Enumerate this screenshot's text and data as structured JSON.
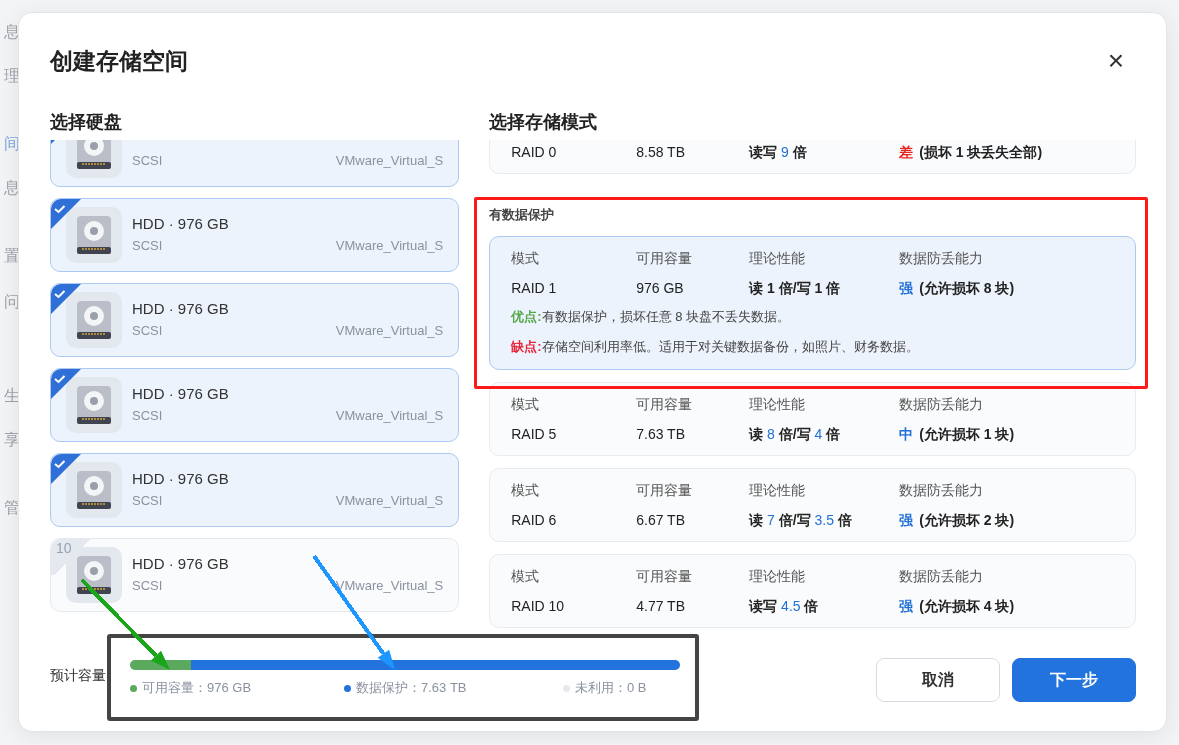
{
  "background_sidebar": [
    {
      "label": "息",
      "selected": false
    },
    {
      "label": "理",
      "selected": false
    },
    {
      "label": "间",
      "selected": true
    },
    {
      "label": "息",
      "selected": false
    },
    {
      "label": "置",
      "selected": false
    },
    {
      "label": "问",
      "selected": false
    },
    {
      "label": "生",
      "selected": false
    },
    {
      "label": "享",
      "selected": false
    },
    {
      "label": "管",
      "selected": false
    }
  ],
  "dialog": {
    "title": "创建存储空间",
    "close": "×"
  },
  "disk_panel": {
    "heading": "选择硬盘",
    "disks": [
      {
        "interface": "SCSI",
        "model": "VMware_Virtual_S",
        "selected": true
      },
      {
        "title": "HDD · 976 GB",
        "interface": "SCSI",
        "model": "VMware_Virtual_S",
        "selected": true
      },
      {
        "title": "HDD · 976 GB",
        "interface": "SCSI",
        "model": "VMware_Virtual_S",
        "selected": true
      },
      {
        "title": "HDD · 976 GB",
        "interface": "SCSI",
        "model": "VMware_Virtual_S",
        "selected": true
      },
      {
        "title": "HDD · 976 GB",
        "interface": "SCSI",
        "model": "VMware_Virtual_S",
        "selected": true
      },
      {
        "title": "HDD · 976 GB",
        "interface": "SCSI",
        "model": "VMware_Virtual_S",
        "selected": false,
        "number": "10"
      }
    ]
  },
  "mode_panel": {
    "heading": "选择存储模式",
    "sections": [
      {
        "cards": [
          {
            "selected": false,
            "mode": "RAID 0",
            "capacity": "8.58 TB",
            "performance": [
              {
                "text": "读写 "
              },
              {
                "text": "9",
                "highlight": true
              },
              {
                "text": " 倍"
              }
            ],
            "rating": {
              "text": "差",
              "color": "#e8261e"
            },
            "rating_note": "(损坏 1 块丢失全部)"
          }
        ]
      },
      {
        "label": "有数据保护",
        "cards": [
          {
            "selected": true,
            "headers": [
              "模式",
              "可用容量",
              "理论性能",
              "数据防丢能力"
            ],
            "mode": "RAID 1",
            "capacity": "976 GB",
            "performance": [
              {
                "text": "读 1 倍/写 1 倍"
              }
            ],
            "rating": {
              "text": "强",
              "color": "#1f6fd6"
            },
            "rating_note": "(允许损坏 8 块)",
            "pros_label": "优点:",
            "pros": "有数据保护，损坏任意 8 块盘不丢失数据。",
            "cons_label": "缺点:",
            "cons": "存储空间利用率低。适用于对关键数据备份，如照片、财务数据。"
          },
          {
            "selected": false,
            "headers": [
              "模式",
              "可用容量",
              "理论性能",
              "数据防丢能力"
            ],
            "mode": "RAID 5",
            "capacity": "7.63 TB",
            "performance": [
              {
                "text": "读 "
              },
              {
                "text": "8",
                "highlight": true
              },
              {
                "text": " 倍/写 "
              },
              {
                "text": "4",
                "highlight": true
              },
              {
                "text": " 倍"
              }
            ],
            "rating": {
              "text": "中",
              "color": "#1f6fd6"
            },
            "rating_note": "(允许损坏 1 块)"
          },
          {
            "selected": false,
            "headers": [
              "模式",
              "可用容量",
              "理论性能",
              "数据防丢能力"
            ],
            "mode": "RAID 6",
            "capacity": "6.67 TB",
            "performance": [
              {
                "text": "读 "
              },
              {
                "text": "7",
                "highlight": true
              },
              {
                "text": " 倍/写 "
              },
              {
                "text": "3.5",
                "highlight": true
              },
              {
                "text": " 倍"
              }
            ],
            "rating": {
              "text": "强",
              "color": "#1f6fd6"
            },
            "rating_note": "(允许损坏 2 块)"
          },
          {
            "selected": false,
            "headers": [
              "模式",
              "可用容量",
              "理论性能",
              "数据防丢能力"
            ],
            "mode": "RAID 10",
            "capacity": "4.77 TB",
            "performance": [
              {
                "text": "读写 "
              },
              {
                "text": "4.5",
                "highlight": true
              },
              {
                "text": " 倍"
              }
            ],
            "rating": {
              "text": "强",
              "color": "#1f6fd6"
            },
            "rating_note": "(允许损坏 4 块)"
          }
        ]
      }
    ]
  },
  "capacity": {
    "label": "预计容量",
    "segments": [
      {
        "name": "可用容量：976 GB",
        "color": "#5aa95e",
        "level": 0.11
      },
      {
        "name": "数据保护：7.63 TB",
        "color": "#2273dd",
        "level": 0.89
      },
      {
        "name": "未利用：0 B",
        "color": "#e6e9ee"
      }
    ]
  },
  "buttons": [
    {
      "label": "取消",
      "kind": "secondary"
    },
    {
      "label": "下一步",
      "kind": "primary"
    }
  ],
  "annotations": [
    {
      "kind": "box",
      "color": "#ff1a1a"
    },
    {
      "kind": "box",
      "color": "#444444"
    },
    {
      "kind": "arrow",
      "color": "#1aa51a"
    },
    {
      "kind": "arrow",
      "color": "#1e96ff"
    }
  ]
}
